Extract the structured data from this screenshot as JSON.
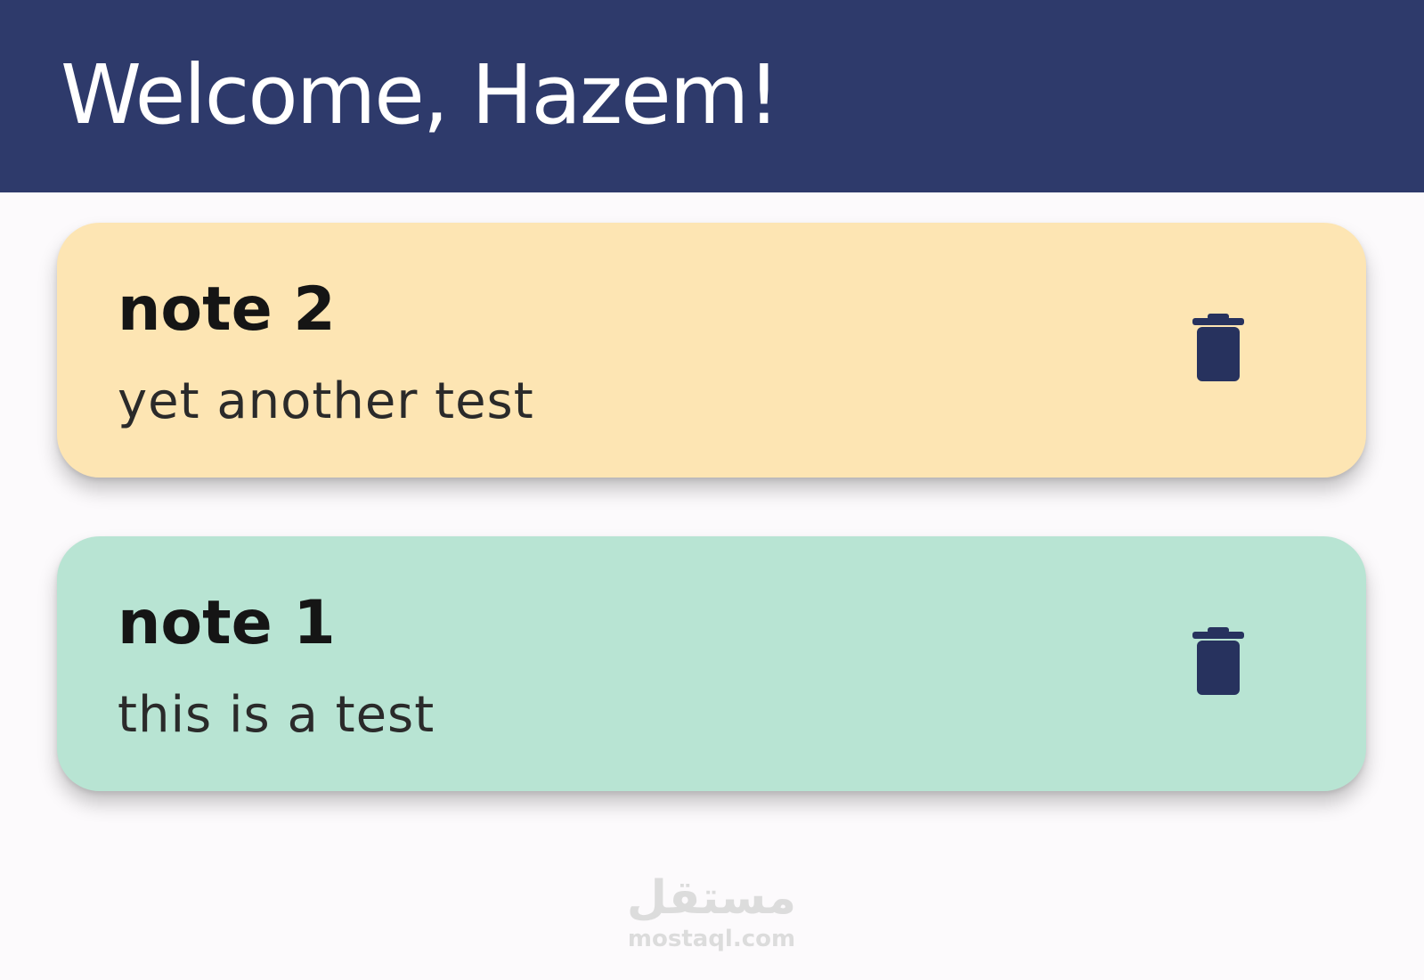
{
  "app_bar": {
    "title": "Welcome, Hazem!",
    "background_color": "#2e3a6b",
    "title_color": "#ffffff"
  },
  "notes": [
    {
      "title": "note 2",
      "body": "yet another test",
      "background_color": "#fde5b3",
      "action_icon": "trash-icon"
    },
    {
      "title": "note 1",
      "body": "this is a test",
      "background_color": "#b8e4d3",
      "action_icon": "trash-icon"
    }
  ],
  "icon_color": "#27325e",
  "page_background_color": "#fcfafc",
  "watermark": {
    "logo_text": "مستقل",
    "url": "mostaql.com"
  }
}
